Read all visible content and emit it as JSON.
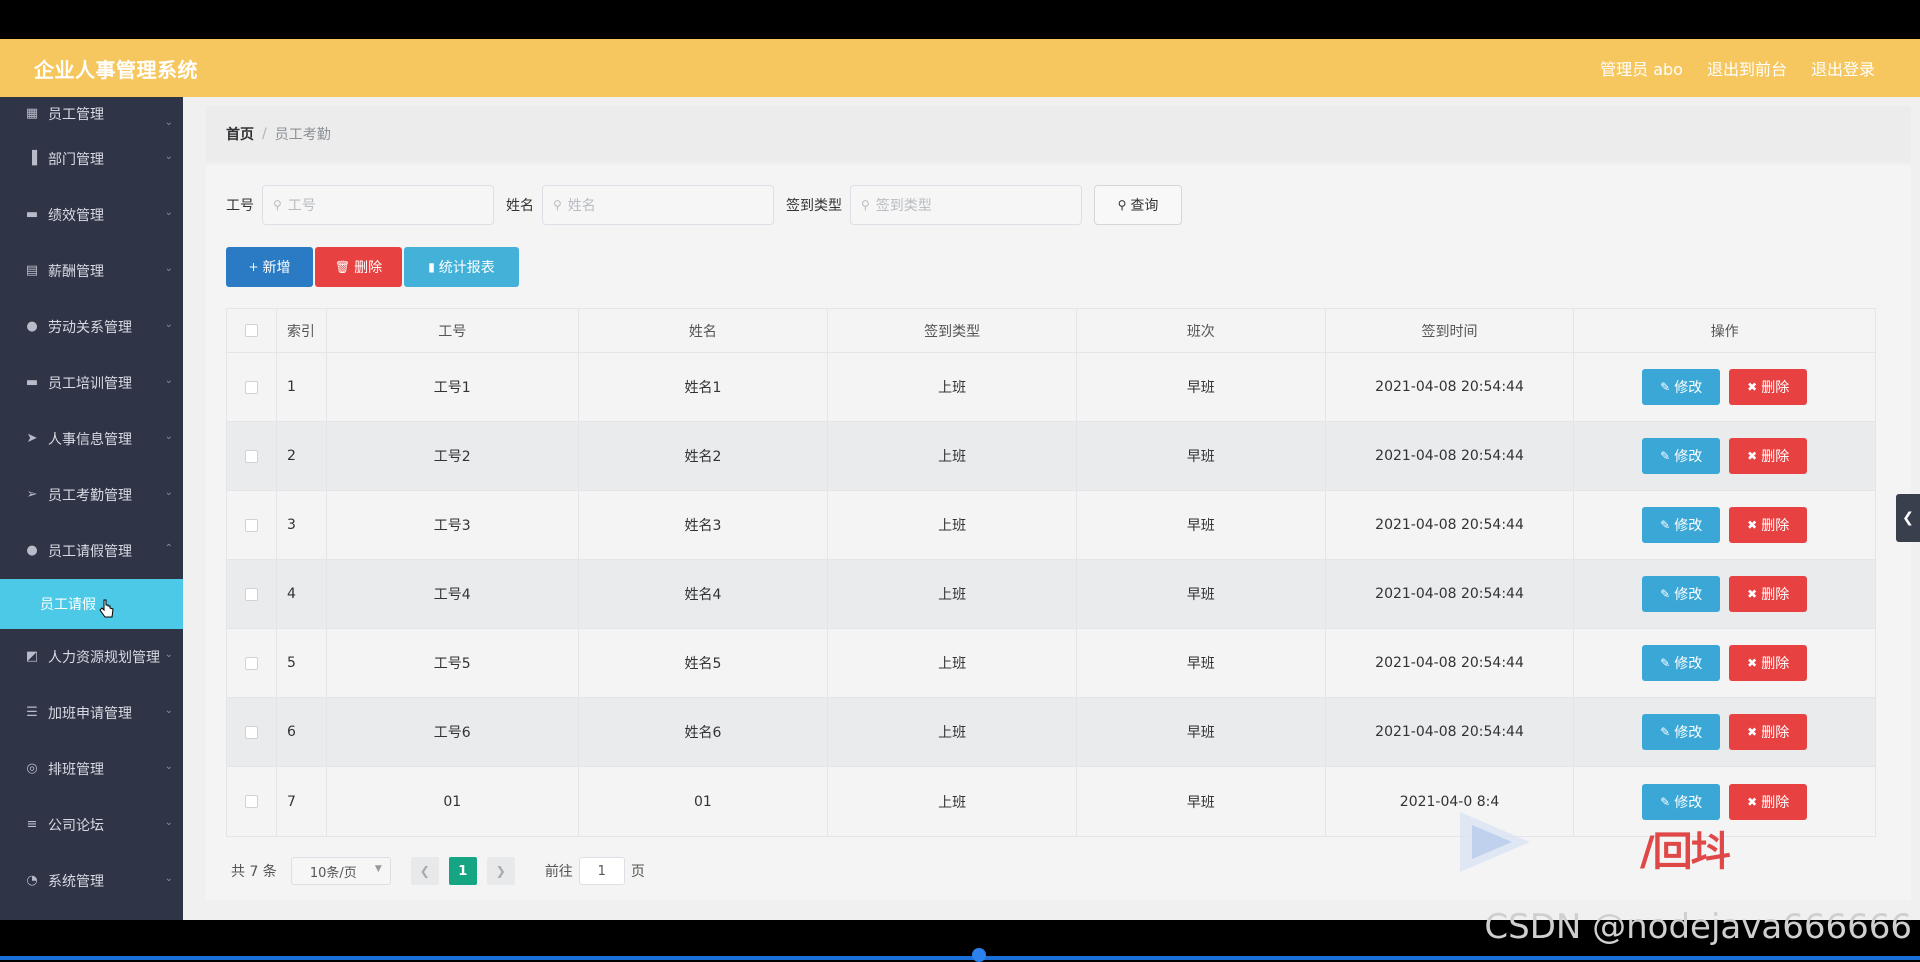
{
  "app": {
    "title": "企业人事管理系统",
    "user": "管理员 abo",
    "to_front": "退出到前台",
    "logout": "退出登录"
  },
  "sidebar": {
    "items": [
      {
        "label": "员工管理",
        "icon": "grid-icon"
      },
      {
        "label": "部门管理",
        "icon": "bar-icon"
      },
      {
        "label": "绩效管理",
        "icon": "monitor-icon"
      },
      {
        "label": "薪酬管理",
        "icon": "card-icon"
      },
      {
        "label": "劳动关系管理",
        "icon": "user-icon"
      },
      {
        "label": "员工培训管理",
        "icon": "monitor-icon"
      },
      {
        "label": "人事信息管理",
        "icon": "send-icon"
      },
      {
        "label": "员工考勤管理",
        "icon": "plane-icon"
      },
      {
        "label": "员工请假管理",
        "icon": "user-icon"
      },
      {
        "label": "人力资源规划管理",
        "icon": "chart-icon"
      },
      {
        "label": "加班申请管理",
        "icon": "list-icon"
      },
      {
        "label": "排班管理",
        "icon": "target-icon"
      },
      {
        "label": "公司论坛",
        "icon": "sliders-icon"
      },
      {
        "label": "系统管理",
        "icon": "gauge-icon"
      }
    ],
    "active_sub": "员工请假"
  },
  "breadcrumb": {
    "home": "首页",
    "sep": "/",
    "current": "员工考勤"
  },
  "search": {
    "no_label": "工号",
    "no_placeholder": "工号",
    "name_label": "姓名",
    "name_placeholder": "姓名",
    "type_label": "签到类型",
    "type_placeholder": "签到类型",
    "query": "查询"
  },
  "actions": {
    "add": "新增",
    "delete": "删除",
    "report": "统计报表"
  },
  "table": {
    "headers": [
      "索引",
      "工号",
      "姓名",
      "签到类型",
      "班次",
      "签到时间",
      "操作"
    ],
    "rows": [
      {
        "idx": "1",
        "no": "工号1",
        "name": "姓名1",
        "type": "上班",
        "shift": "早班",
        "time": "2021-04-08 20:54:44"
      },
      {
        "idx": "2",
        "no": "工号2",
        "name": "姓名2",
        "type": "上班",
        "shift": "早班",
        "time": "2021-04-08 20:54:44"
      },
      {
        "idx": "3",
        "no": "工号3",
        "name": "姓名3",
        "type": "上班",
        "shift": "早班",
        "time": "2021-04-08 20:54:44"
      },
      {
        "idx": "4",
        "no": "工号4",
        "name": "姓名4",
        "type": "上班",
        "shift": "早班",
        "time": "2021-04-08 20:54:44"
      },
      {
        "idx": "5",
        "no": "工号5",
        "name": "姓名5",
        "type": "上班",
        "shift": "早班",
        "time": "2021-04-08 20:54:44"
      },
      {
        "idx": "6",
        "no": "工号6",
        "name": "姓名6",
        "type": "上班",
        "shift": "早班",
        "time": "2021-04-08 20:54:44"
      },
      {
        "idx": "7",
        "no": "01",
        "name": "01",
        "type": "上班",
        "shift": "早班",
        "time": "2021-04-0 8:4"
      }
    ],
    "edit": "修改",
    "remove": "删除"
  },
  "pager": {
    "total": "共 7 条",
    "size": "10条/页",
    "current": "1",
    "goto_prefix": "前往",
    "goto_value": "1",
    "goto_suffix": "页"
  },
  "watermark": {
    "logo_text": "/回㘰",
    "csdn": "CSDN @nodejava666666"
  },
  "colors": {
    "topbar": "#f6c75f",
    "sidebar": "#2f3446",
    "active_sub": "#4cc9e6",
    "primary": "#2a7bc4",
    "danger": "#e84141",
    "info": "#44b2d8",
    "pager_active": "#15a583"
  }
}
